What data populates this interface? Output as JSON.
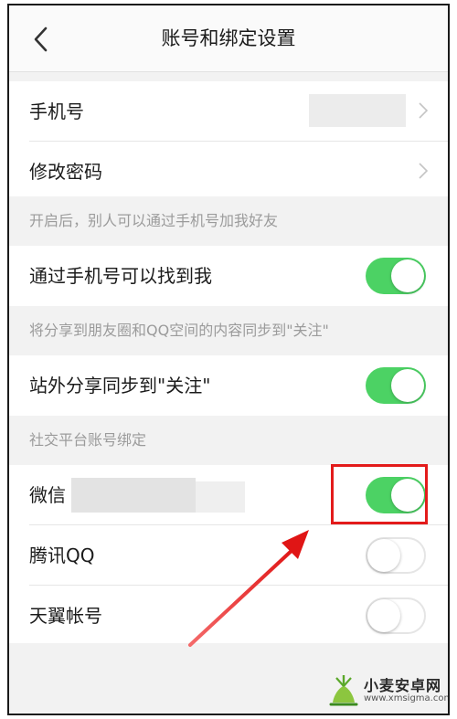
{
  "header": {
    "title": "账号和绑定设置"
  },
  "rows": {
    "phone": {
      "label": "手机号"
    },
    "password": {
      "label": "修改密码"
    }
  },
  "sections": {
    "find_by_phone_hint": "开启后，别人可以通过手机号加我好友",
    "share_sync_hint": "将分享到朋友圈和QQ空间的内容同步到\"关注\"",
    "social_binding": "社交平台账号绑定"
  },
  "toggles": {
    "find_by_phone": {
      "label": "通过手机号可以找到我",
      "state": "on"
    },
    "share_sync": {
      "label": "站外分享同步到\"关注\"",
      "state": "on"
    },
    "wechat": {
      "label": "微信",
      "state": "on"
    },
    "tencent_qq": {
      "label": "腾讯QQ",
      "state": "off"
    },
    "tianyi": {
      "label": "天翼帐号",
      "state": "off"
    }
  },
  "colors": {
    "toggle_on": "#4cd264",
    "highlight_box": "#e31b1b",
    "arrow": "#e31b1b",
    "section_bg": "#f2f2f2"
  },
  "watermark": {
    "name": "小麦安卓网",
    "url": "www.xmsigma.com"
  }
}
